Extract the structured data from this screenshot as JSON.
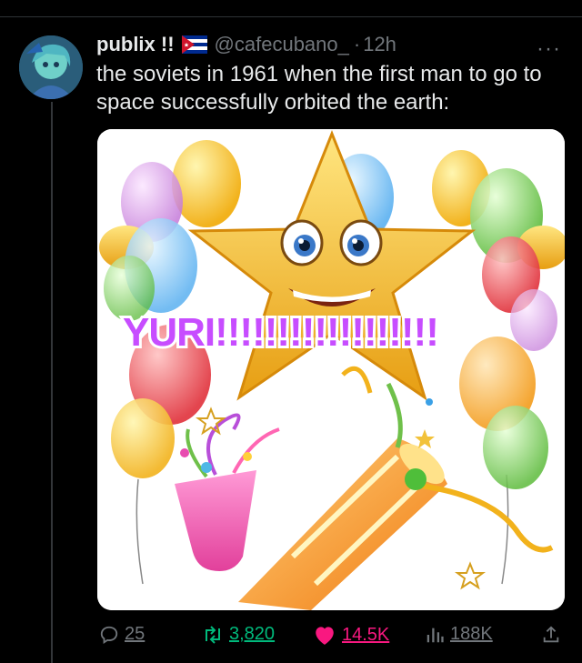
{
  "tweet": {
    "display_name": "publix !!",
    "flag_icon": "cuba-flag-icon",
    "handle": "@cafecubano_",
    "separator": "·",
    "time": "12h",
    "more": "···",
    "text": "the soviets in 1961 when the first man to go to space successfully orbited the earth:",
    "media": {
      "caption_text": "YURI!!!!!!!!!!!!!!!!!!"
    }
  },
  "actions": {
    "reply_count": "25",
    "retweet_count": "3,820",
    "like_count": "14.5K",
    "views_count": "188K"
  },
  "colors": {
    "background": "#000000",
    "text": "#e7e9ea",
    "muted": "#71767b",
    "retweet": "#00ba7c",
    "like": "#f91880",
    "meme_text": "#c74dff"
  }
}
